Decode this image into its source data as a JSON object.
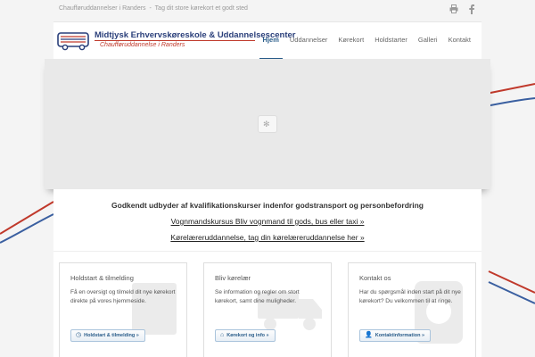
{
  "topbar": {
    "site_name": "Chaufføruddannelser i Randers",
    "separator": "-",
    "tagline": "Tag dit store kørekort et godt sted",
    "icons": [
      "printer-icon",
      "facebook-icon"
    ]
  },
  "logo": {
    "title": "Midtjysk Erhvervskøreskole & Uddannelsescenter",
    "subtitle": "Chaufføruddannelse i Randers"
  },
  "nav": {
    "items": [
      {
        "label": "Hjem",
        "active": true
      },
      {
        "label": "Uddannelser",
        "active": false
      },
      {
        "label": "Kørekort",
        "active": false
      },
      {
        "label": "Holdstarter",
        "active": false
      },
      {
        "label": "Galleri",
        "active": false
      },
      {
        "label": "Kontakt",
        "active": false
      }
    ]
  },
  "main": {
    "headline": "Godkendt udbyder af kvalifikationskurser indenfor godstransport og personbefordring",
    "link1": "Vognmandskursus Bliv vognmand til gods, bus eller taxi »",
    "link2": "Kørelæreruddannelse, tag din kørelæreruddannelse her »"
  },
  "cards": [
    {
      "title": "Holdstart & tilmelding",
      "text": "Få en oversigt og tilmeld dit nye kørekort direkte på vores hjemmeside.",
      "button": "Holdstart & tilmelding »",
      "button_icon": "clock-icon"
    },
    {
      "title": "Bliv kørelær",
      "text": "Se information og regler om stort kørekort, samt dine muligheder.",
      "button": "Kørekort og info »",
      "button_icon": "home-icon"
    },
    {
      "title": "Kontakt os",
      "text": "Har du spørgsmål inden start på dit nye kørekort? Du velkommen til at ringe.",
      "button": "Kontaktinformation »",
      "button_icon": "person-icon"
    }
  ],
  "colors": {
    "brand_blue": "#2a3f7a",
    "brand_red": "#c0392b",
    "accent": "#2a5d8a"
  }
}
